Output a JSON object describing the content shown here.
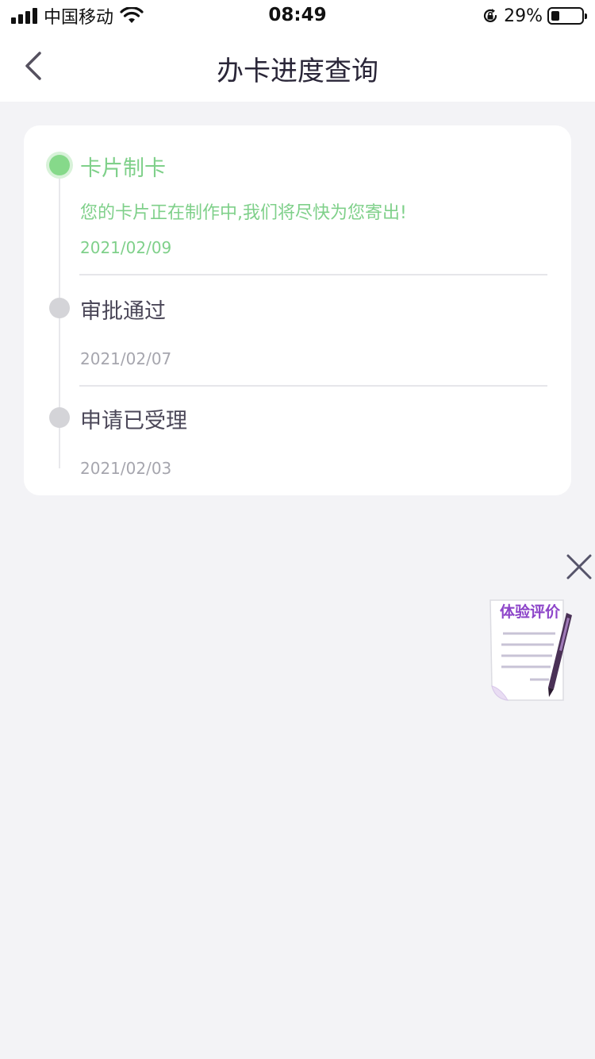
{
  "status_bar": {
    "carrier": "中国移动",
    "time": "08:49",
    "battery_percent": "29%",
    "battery_level": 0.29
  },
  "nav": {
    "title": "办卡进度查询",
    "back_icon": "chevron-left-icon"
  },
  "progress": {
    "steps": [
      {
        "title": "卡片制卡",
        "desc": "您的卡片正在制作中,我们将尽快为您寄出!",
        "date": "2021/02/09",
        "active": true
      },
      {
        "title": "审批通过",
        "desc": "",
        "date": "2021/02/07",
        "active": false
      },
      {
        "title": "申请已受理",
        "desc": "",
        "date": "2021/02/03",
        "active": false
      }
    ]
  },
  "float": {
    "close_icon": "close-icon",
    "feedback_label": "体验评价",
    "feedback_icon": "document-pen-icon"
  },
  "colors": {
    "active_green": "#7fd08a",
    "accent_purple": "#8d45c9",
    "background": "#f3f3f6"
  }
}
